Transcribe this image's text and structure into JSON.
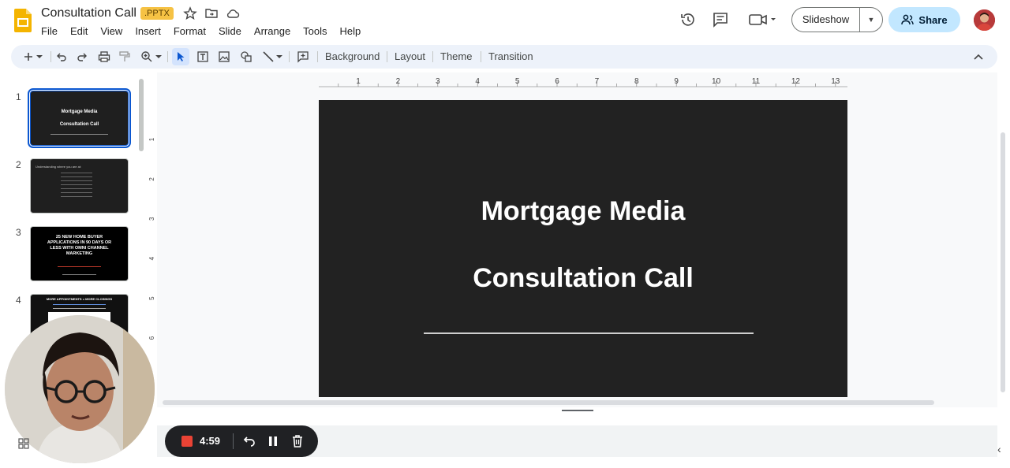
{
  "document": {
    "title": "Consultation Call",
    "format_badge": ".PPTX"
  },
  "menu": [
    "File",
    "Edit",
    "View",
    "Insert",
    "Format",
    "Slide",
    "Arrange",
    "Tools",
    "Help"
  ],
  "header_buttons": {
    "slideshow": "Slideshow",
    "share": "Share"
  },
  "toolbar": {
    "background": "Background",
    "layout": "Layout",
    "theme": "Theme",
    "transition": "Transition"
  },
  "ruler": {
    "top_ticks": [
      "1",
      "2",
      "3",
      "4",
      "5",
      "6",
      "7",
      "8",
      "9",
      "10",
      "11",
      "12",
      "13"
    ],
    "left_ticks": [
      "1",
      "2",
      "3",
      "4",
      "5",
      "6"
    ]
  },
  "slides": [
    {
      "number": "1",
      "lines": [
        "Mortgage Media",
        "Consultation Call"
      ]
    },
    {
      "number": "2",
      "lines": [
        "Understanding where you are at:"
      ]
    },
    {
      "number": "3",
      "lines": [
        "25 NEW HOME BUYER",
        "APPLICATIONS IN 90 DAYS OR",
        "LESS WITH OMNI CHANNEL",
        "MARKETING"
      ]
    },
    {
      "number": "4",
      "lines": [
        "MORE APPOINTMENTS = MORE CLOSINGS"
      ]
    }
  ],
  "current_slide": {
    "title_line1": "Mortgage Media",
    "title_line2": "Consultation Call"
  },
  "recorder": {
    "time": "4:59"
  },
  "colors": {
    "accent": "#0b57d0",
    "share_bg": "#c2e7ff",
    "slide_bg": "#222222",
    "toolbar_bg": "#edf2fa",
    "badge_bg": "#f6c244",
    "record_red": "#ea4335"
  }
}
